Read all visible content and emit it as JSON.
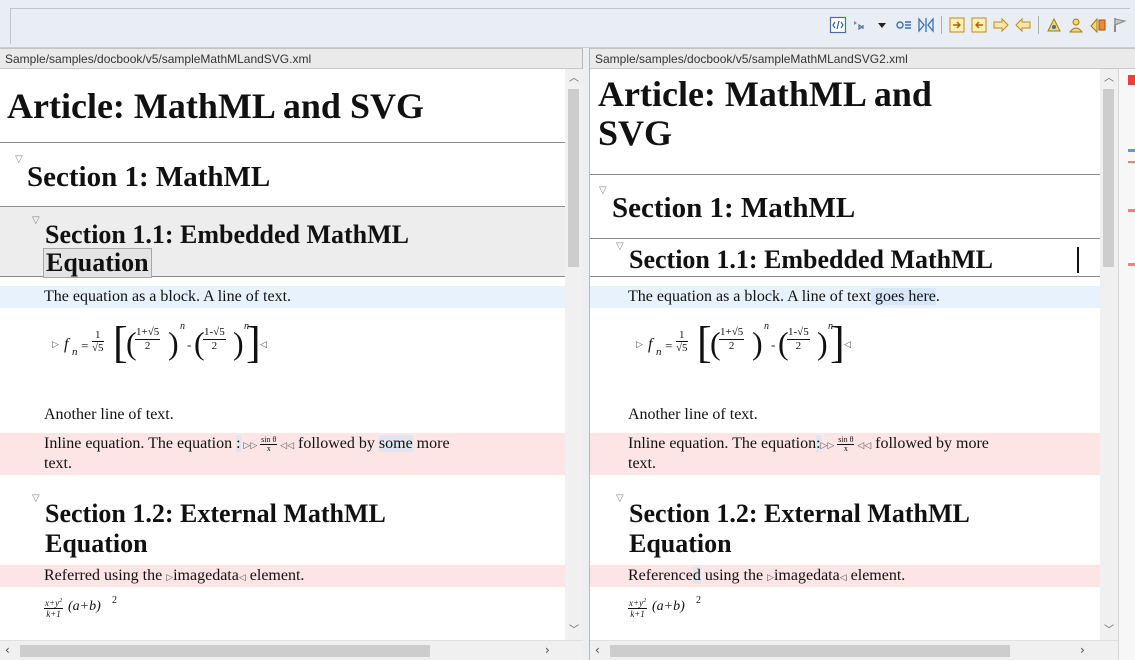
{
  "toolbar": {
    "icons": [
      "tags-display-icon",
      "toggle-tags-icon",
      "dropdown-icon",
      "settings-icon",
      "compare-icon",
      "next-change-icon",
      "previous-change-icon",
      "copy-right-icon",
      "copy-left-icon",
      "person-icon",
      "person-two-icon",
      "merge-icon",
      "flag-icon"
    ]
  },
  "left": {
    "path": "Sample/samples/docbook/v5/sampleMathMLandSVG.xml",
    "article_title": "Article: MathML and SVG",
    "section1": "Section 1: MathML",
    "section11_line1": "Section 1.1: Embedded MathML",
    "section11_line2": "Equation",
    "para_block": "The equation as a block. A line of text.",
    "para_another": "Another line of text.",
    "inline_prefix": "Inline equation. The equation ",
    "inline_sep": ":",
    "inline_middle": " followed by ",
    "inline_some": "some",
    "inline_suffix": " more",
    "inline_line2": "text.",
    "section12_line1": "Section 1.2: External MathML",
    "section12_line2": "Equation",
    "ref_prefix": "Referred using the ",
    "ref_tag": "imagedata",
    "ref_suffix": " element."
  },
  "right": {
    "path": "Sample/samples/docbook/v5/sampleMathMLandSVG2.xml",
    "article_title_line1": "Article: MathML and",
    "article_title_line2": "SVG",
    "section1": "Section 1: MathML",
    "section11": "Section 1.1: Embedded MathML",
    "para_block_prefix": "The equation as a block. A line of text",
    "para_block_added": " goes here",
    "para_block_end": ".",
    "para_another": "Another line of text.",
    "inline_prefix": "Inline equation. The equation",
    "inline_sep": ":",
    "inline_middle": " followed by more",
    "inline_line2": "text.",
    "section12_line1": "Section 1.2: External MathML",
    "section12_line2": "Equation",
    "ref_prefix": "Reference",
    "ref_added": "d",
    "ref_middle": " using the ",
    "ref_tag": "imagedata",
    "ref_suffix": " element."
  },
  "math": {
    "f": "f",
    "n": "n",
    "eq": "=",
    "one": "1",
    "sqrt5": "√5",
    "one_plus_sqrt5": "1+√5",
    "one_minus_sqrt5": "1-√5",
    "two": "2",
    "minus": "-",
    "sin_num": "sin θ",
    "sin_den": "x",
    "ext_num": "x+y",
    "ext_num_exp": "2",
    "ext_den": "k+1",
    "ext_paren": "(a+b)",
    "ext_exp": "2"
  }
}
